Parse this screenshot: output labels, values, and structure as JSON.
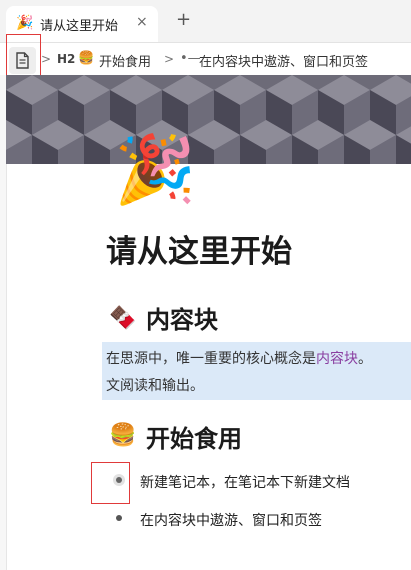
{
  "tab": {
    "icon": "🎉",
    "title": "请从这里开始",
    "close": "×",
    "add": "+"
  },
  "breadcrumb": {
    "doc_icon": "document-icon",
    "heading_level": "H2",
    "heading_icon": "🍔",
    "heading_text": "开始食用",
    "item_prefix": "•—",
    "item_text": "在内容块中遨游、窗口和页签"
  },
  "document": {
    "icon": "🎉",
    "title": "请从这里开始",
    "section1": {
      "icon": "🍫",
      "heading": "内容块",
      "para_line1_before": "在思源中，唯一重要的核心概念是",
      "para_link": "内容块",
      "para_line1_after": "。",
      "para_line2": "文阅读和输出。"
    },
    "section2": {
      "icon": "🍔",
      "heading": "开始食用",
      "items": [
        {
          "text": "新建笔记本，在笔记本下新建文档",
          "is_link": false
        },
        {
          "text": "在内容块中遨游、窗口和页签",
          "is_link": true
        }
      ]
    }
  },
  "colors": {
    "highlight_box": "#e03a3a",
    "link": "#8a3fa1",
    "paragraph_bg": "#dbe9f8"
  }
}
